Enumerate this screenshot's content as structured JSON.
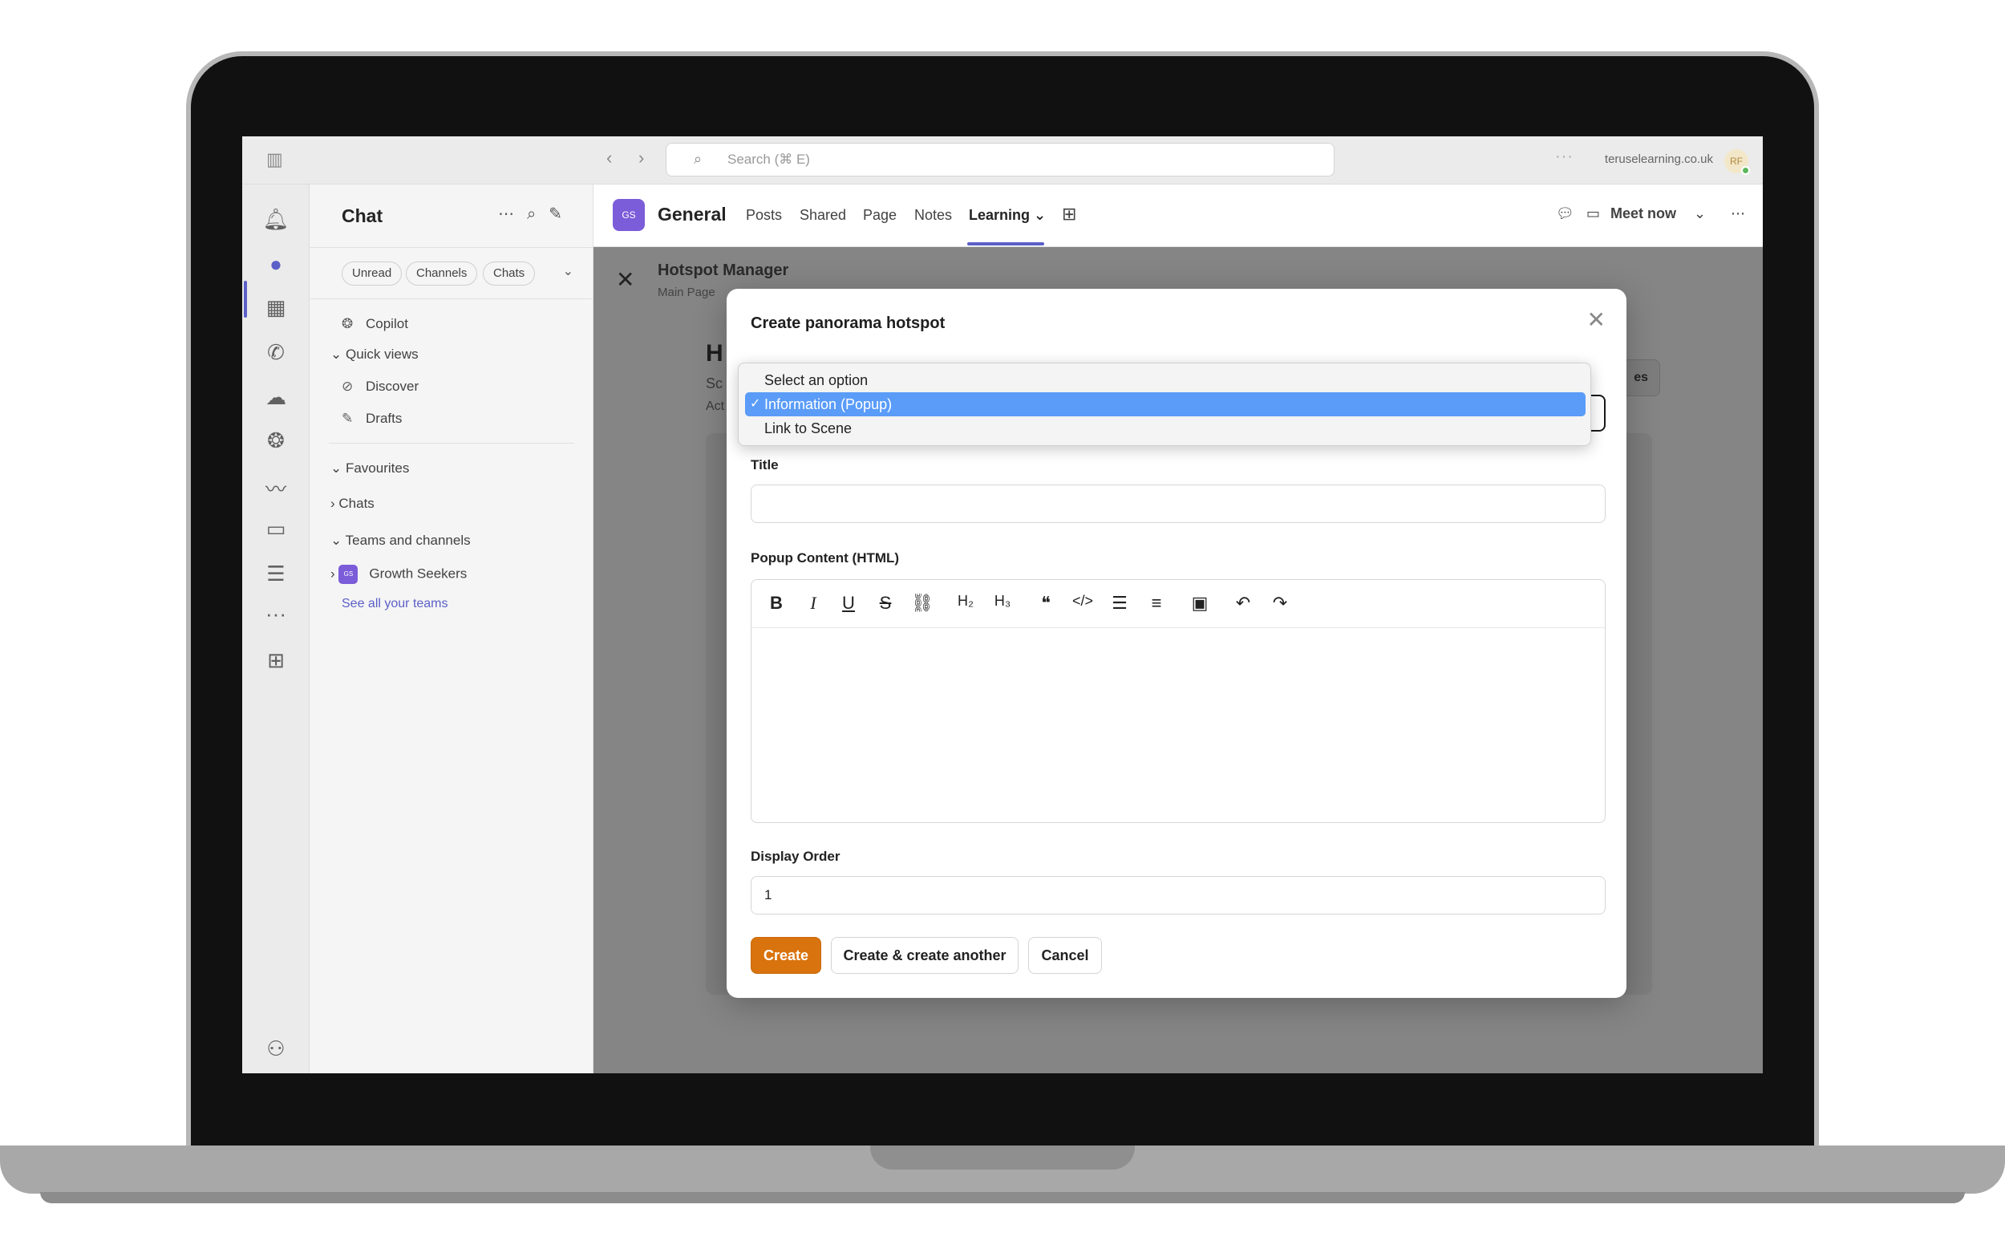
{
  "topbar": {
    "search_placeholder": "Search (⌘ E)",
    "org": "teruselearning.co.uk",
    "avatar_initials": "RF"
  },
  "chat": {
    "title": "Chat",
    "filters": [
      "Unread",
      "Channels",
      "Chats"
    ],
    "copilot": "Copilot",
    "quick_views": "Quick views",
    "discover": "Discover",
    "drafts": "Drafts",
    "favourites": "Favourites",
    "chats": "Chats",
    "teams_and_channels": "Teams and channels",
    "team_badge": "GS",
    "team_name": "Growth Seekers",
    "see_all": "See all your teams"
  },
  "channel": {
    "badge": "GS",
    "name": "General",
    "tabs": [
      "Posts",
      "Shared",
      "Page",
      "Notes",
      "Learning"
    ],
    "active_tab": "Learning",
    "meet_now": "Meet now"
  },
  "hotspot_manager": {
    "title": "Hotspot Manager",
    "subtitle": "Main Page",
    "bg_heading": "H",
    "bg_line1": "Sc",
    "bg_line2": "Act",
    "bg_button": "es"
  },
  "modal": {
    "title": "Create panorama hotspot",
    "type_options": [
      "Select an option",
      "Information (Popup)",
      "Link to Scene"
    ],
    "type_selected": "Information (Popup)",
    "title_label": "Title",
    "title_value": "",
    "content_label": "Popup Content (HTML)",
    "order_label": "Display Order",
    "order_value": "1",
    "create": "Create",
    "create_another": "Create & create another",
    "cancel": "Cancel"
  },
  "colors": {
    "accent": "#5b5fc7",
    "primary_button": "#d9730d",
    "dropdown_selected": "#5a9cf8",
    "team_badge": "#7b5cd9"
  }
}
